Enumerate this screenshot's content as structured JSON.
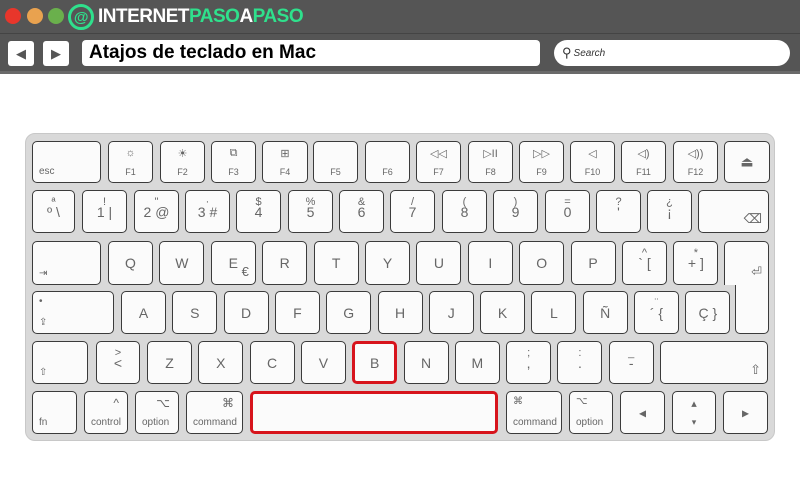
{
  "window": {
    "traffic_lights": [
      "#e8362b",
      "#e9a24f",
      "#6ab04c"
    ],
    "logo": {
      "part1": "INTERNET",
      "part2": "PASO",
      "part3": "A",
      "part4": "PASO",
      "accent": "#2fe08c",
      "mark": "@"
    }
  },
  "nav": {
    "back_icon": "◀",
    "forward_icon": "▶",
    "address": "Atajos de teclado en Mac",
    "search_placeholder": "Search"
  },
  "highlight_color": "#d7141c",
  "keys": [
    {
      "bl": "esc"
    },
    {
      "t": "☼",
      "b": "F1"
    },
    {
      "t": "☀",
      "b": "F2"
    },
    {
      "t": "⧉",
      "b": "F3"
    },
    {
      "t": "⊞",
      "b": "F4"
    },
    {
      "b": "F5"
    },
    {
      "b": "F6"
    },
    {
      "t": "◁◁",
      "b": "F7"
    },
    {
      "t": "▷II",
      "b": "F8"
    },
    {
      "t": "▷▷",
      "b": "F9"
    },
    {
      "t": "◁",
      "b": "F10"
    },
    {
      "t": "◁)",
      "b": "F11"
    },
    {
      "t": "◁))",
      "b": "F12"
    },
    {
      "m": "⏏"
    },
    {
      "t": "ª",
      "m": "º \\"
    },
    {
      "t": "!",
      "m": "1 |"
    },
    {
      "t": "\"",
      "m": "2 @"
    },
    {
      "t": "·",
      "m": "3 #"
    },
    {
      "t": "$",
      "m": "4"
    },
    {
      "t": "%",
      "m": "5"
    },
    {
      "t": "&",
      "m": "6"
    },
    {
      "t": "/",
      "m": "7"
    },
    {
      "t": "(",
      "m": "8"
    },
    {
      "t": ")",
      "m": "9"
    },
    {
      "t": "=",
      "m": "0"
    },
    {
      "t": "?",
      "m": "'"
    },
    {
      "t": "¿",
      "m": "¡"
    },
    {
      "br": "⌫"
    },
    {
      "bl": "⇥"
    },
    {
      "m": "Q"
    },
    {
      "m": "W"
    },
    {
      "m": "E",
      "br": "€"
    },
    {
      "m": "R"
    },
    {
      "m": "T"
    },
    {
      "m": "Y"
    },
    {
      "m": "U"
    },
    {
      "m": "I"
    },
    {
      "m": "O"
    },
    {
      "m": "P"
    },
    {
      "t": "^",
      "m": "` ["
    },
    {
      "t": "*",
      "m": "+ ]"
    },
    {
      "br": "⏎"
    },
    {
      "tl": "•",
      "bl": "⇪"
    },
    {
      "m": "A"
    },
    {
      "m": "S"
    },
    {
      "m": "D"
    },
    {
      "m": "F"
    },
    {
      "m": "G"
    },
    {
      "m": "H"
    },
    {
      "m": "J"
    },
    {
      "m": "K"
    },
    {
      "m": "L"
    },
    {
      "m": "Ñ"
    },
    {
      "t": "¨",
      "m": "´ {"
    },
    {
      "m": "Ç }"
    },
    {},
    {
      "bl": "⇧"
    },
    {
      "t": ">",
      "m": "<"
    },
    {
      "m": "Z"
    },
    {
      "m": "X"
    },
    {
      "m": "C"
    },
    {
      "m": "V"
    },
    {
      "m": "B"
    },
    {
      "m": "N"
    },
    {
      "m": "M"
    },
    {
      "t": ";",
      "m": ","
    },
    {
      "t": ":",
      "m": "."
    },
    {
      "t": "_",
      "m": "-"
    },
    {
      "br": "⇧"
    },
    {
      "bl": "fn"
    },
    {
      "tr": "^",
      "bl": "control"
    },
    {
      "tr": "⌥",
      "bl": "option"
    },
    {
      "tr": "⌘",
      "bl": "command"
    },
    {},
    {
      "tl": "⌘",
      "bl": "command"
    },
    {
      "tl": "⌥",
      "bl": "option"
    },
    {
      "m": "◂"
    },
    {
      "t": "▴",
      "b": "▾"
    },
    {
      "m": "▸"
    }
  ],
  "highlighted_keys": [
    "B",
    "command-left"
  ]
}
